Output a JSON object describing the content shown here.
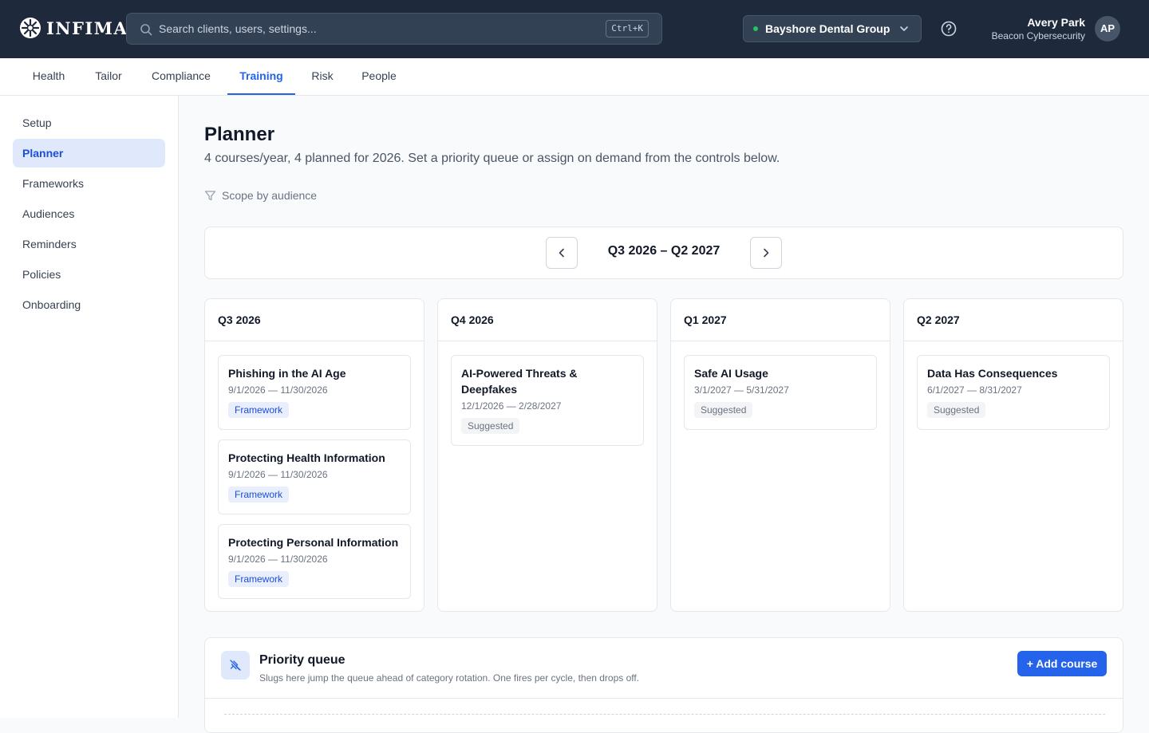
{
  "app": {
    "logo_text": "INFIMA",
    "search": {
      "placeholder": "Search clients, users, settings...",
      "shortcut": "Ctrl+K"
    },
    "client_selector": {
      "name": "Bayshore Dental Group",
      "status_color": "#22c55e"
    },
    "user": {
      "name": "Avery Park",
      "org": "Beacon Cybersecurity",
      "initials": "AP"
    }
  },
  "tabs": [
    {
      "label": "Health",
      "active": false
    },
    {
      "label": "Tailor",
      "active": false
    },
    {
      "label": "Compliance",
      "active": false
    },
    {
      "label": "Training",
      "active": true
    },
    {
      "label": "Risk",
      "active": false
    },
    {
      "label": "People",
      "active": false
    }
  ],
  "sidebar": {
    "items": [
      {
        "label": "Setup",
        "active": false
      },
      {
        "label": "Planner",
        "active": true
      },
      {
        "label": "Frameworks",
        "active": false
      },
      {
        "label": "Audiences",
        "active": false
      },
      {
        "label": "Reminders",
        "active": false
      },
      {
        "label": "Policies",
        "active": false
      },
      {
        "label": "Onboarding",
        "active": false
      }
    ]
  },
  "main": {
    "title": "Planner",
    "subtitle": "4 courses/year, 4 planned for 2026. Set a priority queue or assign on demand from the controls below.",
    "scope_label": "Scope by audience",
    "range_label": "Q3 2026 – Q2 2027",
    "quarters": [
      {
        "label": "Q3 2026",
        "courses": [
          {
            "title": "Phishing in the AI Age",
            "dates": "9/1/2026 — 11/30/2026",
            "badge": "Framework"
          },
          {
            "title": "Protecting Health Information",
            "dates": "9/1/2026 — 11/30/2026",
            "badge": "Framework"
          },
          {
            "title": "Protecting Personal Information",
            "dates": "9/1/2026 — 11/30/2026",
            "badge": "Framework"
          }
        ]
      },
      {
        "label": "Q4 2026",
        "courses": [
          {
            "title": "AI-Powered Threats & Deepfakes",
            "dates": "12/1/2026 — 2/28/2027",
            "badge": "Suggested"
          }
        ]
      },
      {
        "label": "Q1 2027",
        "courses": [
          {
            "title": "Safe AI Usage",
            "dates": "3/1/2027 — 5/31/2027",
            "badge": "Suggested"
          }
        ]
      },
      {
        "label": "Q2 2027",
        "courses": [
          {
            "title": "Data Has Consequences",
            "dates": "6/1/2027 — 8/31/2027",
            "badge": "Suggested"
          }
        ]
      }
    ],
    "priority_queue": {
      "title": "Priority queue",
      "description": "Slugs here jump the queue ahead of category rotation. One fires per cycle, then drops off.",
      "add_label": "+ Add course"
    }
  },
  "colors": {
    "topbar": "#1e293b",
    "accent": "#2563eb",
    "framework_badge_bg": "#e8eefb",
    "suggested_badge_bg": "#f3f4f6"
  },
  "icons": [
    "logo-mark-icon",
    "search-icon",
    "chevron-down-icon",
    "help-circle-icon",
    "filter-icon",
    "chevron-left-icon",
    "chevron-right-icon",
    "pin-off-icon"
  ]
}
